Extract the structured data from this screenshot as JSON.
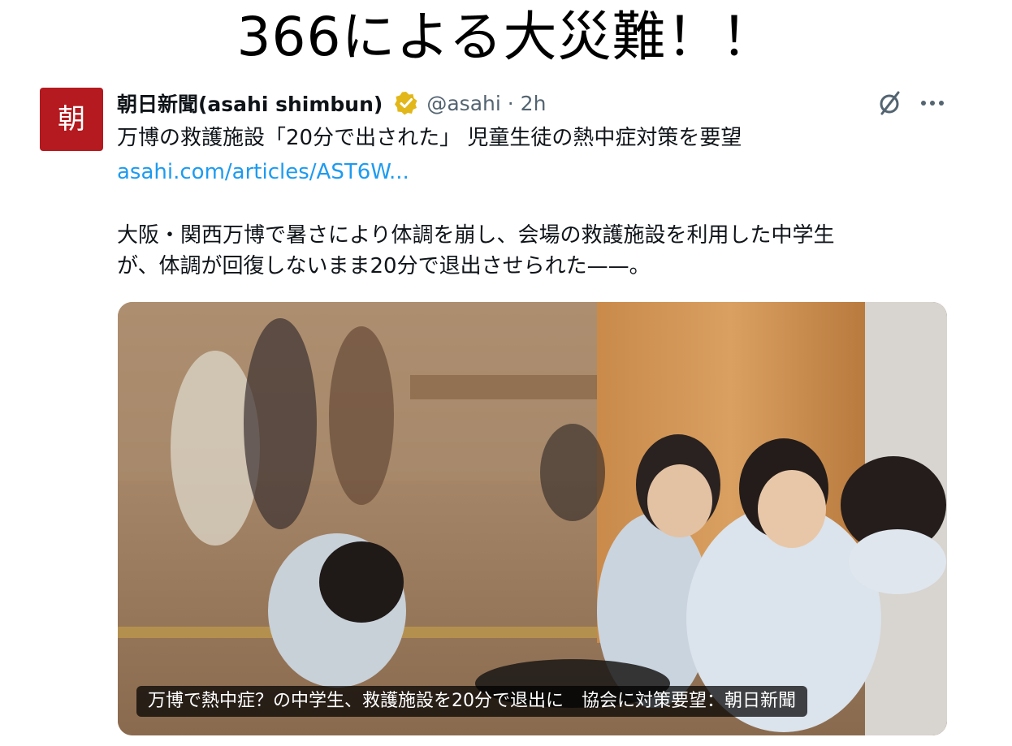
{
  "headline": "366による大災難！！",
  "tweet": {
    "avatar_glyph": "朝",
    "display_name": "朝日新聞(asahi shimbun)",
    "handle": "@asahi",
    "separator": "·",
    "time": "2h",
    "line1": "万博の救護施設「20分で出された」 児童生徒の熱中症対策を要望",
    "link": "asahi.com/articles/AST6W...",
    "body_line1": "大阪・関西万博で暑さにより体調を崩し、会場の救護施設を利用した中学生",
    "body_line2": "が、体調が回復しないまま20分で退出させられた——。",
    "card_caption": "万博で熱中症？の中学生、救護施設を20分で退出に　協会に対策要望：朝日新聞"
  },
  "icons": {
    "verified": "verified-badge-icon",
    "grok": "grok-icon",
    "more": "more-icon"
  },
  "colors": {
    "avatar_bg": "#b41a1f",
    "link": "#1d9bf0",
    "secondary_text": "#536471",
    "verified_gold": "#e2b719"
  }
}
